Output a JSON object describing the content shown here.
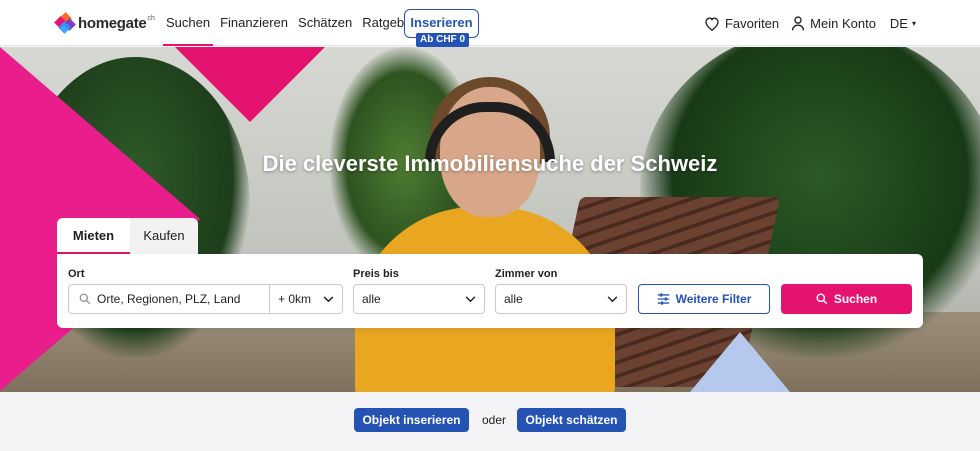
{
  "header": {
    "logo_text": "homegate",
    "logo_suffix": "ch",
    "nav": [
      {
        "label": "Suchen",
        "active": true
      },
      {
        "label": "Finanzieren",
        "active": false
      },
      {
        "label": "Schätzen",
        "active": false
      },
      {
        "label": "Ratgeber",
        "active": false
      }
    ],
    "insert_button": "Inserieren",
    "insert_badge": "Ab CHF 0",
    "favorites": "Favoriten",
    "account": "Mein Konto",
    "language": "DE"
  },
  "hero": {
    "title": "Die cleverste Immobiliensuche der Schweiz"
  },
  "search": {
    "tabs": [
      {
        "label": "Mieten",
        "active": true
      },
      {
        "label": "Kaufen",
        "active": false
      }
    ],
    "location_label": "Ort",
    "location_placeholder": "Orte, Regionen, PLZ, Land",
    "radius": "+ 0km",
    "price_label": "Preis bis",
    "price_value": "alle",
    "rooms_label": "Zimmer von",
    "rooms_value": "alle",
    "filter_button": "Weitere Filter",
    "search_button": "Suchen"
  },
  "bottom": {
    "insert_object": "Objekt inserieren",
    "or": "oder",
    "estimate_object": "Objekt schätzen"
  },
  "colors": {
    "brand_pink": "#e4136f",
    "brand_blue": "#2553b4"
  },
  "icons": [
    "heart-icon",
    "user-icon",
    "chevron-down-icon",
    "search-icon",
    "filter-sliders-icon"
  ]
}
